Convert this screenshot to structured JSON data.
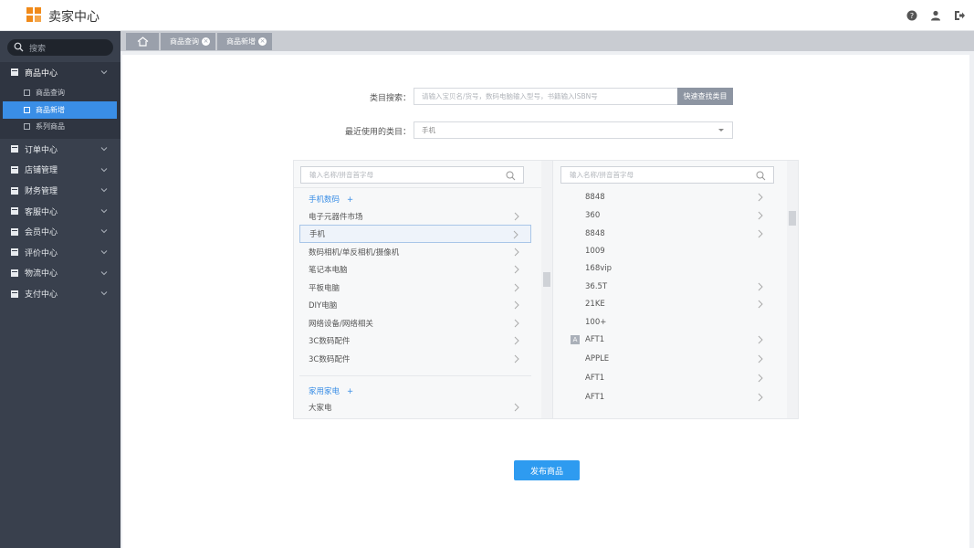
{
  "app": {
    "title": "卖家中心"
  },
  "sidebar": {
    "search_placeholder": "搜索",
    "menu": [
      {
        "label": "商品中心"
      },
      {
        "label": "订单中心"
      },
      {
        "label": "店铺管理"
      },
      {
        "label": "财务管理"
      },
      {
        "label": "客服中心"
      },
      {
        "label": "会员中心"
      },
      {
        "label": "评价中心"
      },
      {
        "label": "物流中心"
      },
      {
        "label": "支付中心"
      }
    ],
    "submenu": [
      {
        "label": "商品查询"
      },
      {
        "label": "商品新增"
      },
      {
        "label": "系列商品"
      }
    ]
  },
  "tabs": [
    {
      "label": "商品查询"
    },
    {
      "label": "商品新增"
    }
  ],
  "form": {
    "category_search_label": "类目搜索：",
    "category_search_placeholder": "请输入宝贝名/货号，数码电脑输入型号，书籍输入ISBN号",
    "quick_find_button": "快速查找类目",
    "recent_label": "最近使用的类目：",
    "recent_value": "手机"
  },
  "left_column": {
    "filter_placeholder": "输入名称/拼音首字母",
    "groups": [
      {
        "label": "手机数码",
        "toggle": "+",
        "items": [
          "电子元器件市场",
          "手机",
          "数码相机/单反相机/摄像机",
          "笔记本电脑",
          "平板电脑",
          "DIY电脑",
          "网络设备/网络相关",
          "3C数码配件",
          "3C数码配件"
        ]
      },
      {
        "label": "家用家电",
        "toggle": "+",
        "items": [
          "大家电"
        ]
      }
    ]
  },
  "right_column": {
    "filter_placeholder": "输入名称/拼音首字母",
    "letter_marker": "A",
    "items": [
      {
        "label": "8848",
        "has_children": true
      },
      {
        "label": "360",
        "has_children": true
      },
      {
        "label": "8848",
        "has_children": true
      },
      {
        "label": "1009",
        "has_children": false
      },
      {
        "label": "168vip",
        "has_children": false
      },
      {
        "label": "36.5T",
        "has_children": true
      },
      {
        "label": "21KE",
        "has_children": true
      },
      {
        "label": "100+",
        "has_children": false
      },
      {
        "label": "AFT1",
        "has_children": true
      },
      {
        "label": "APPLE",
        "has_children": true
      },
      {
        "label": "AFT1",
        "has_children": true
      },
      {
        "label": "AFT1",
        "has_children": true
      }
    ]
  },
  "actions": {
    "publish_label": "发布商品"
  },
  "colors": {
    "accent": "#3a8ee6",
    "sidebar_bg": "#39404d",
    "logo": "#f08a1a",
    "publish": "#2e9bf0"
  }
}
